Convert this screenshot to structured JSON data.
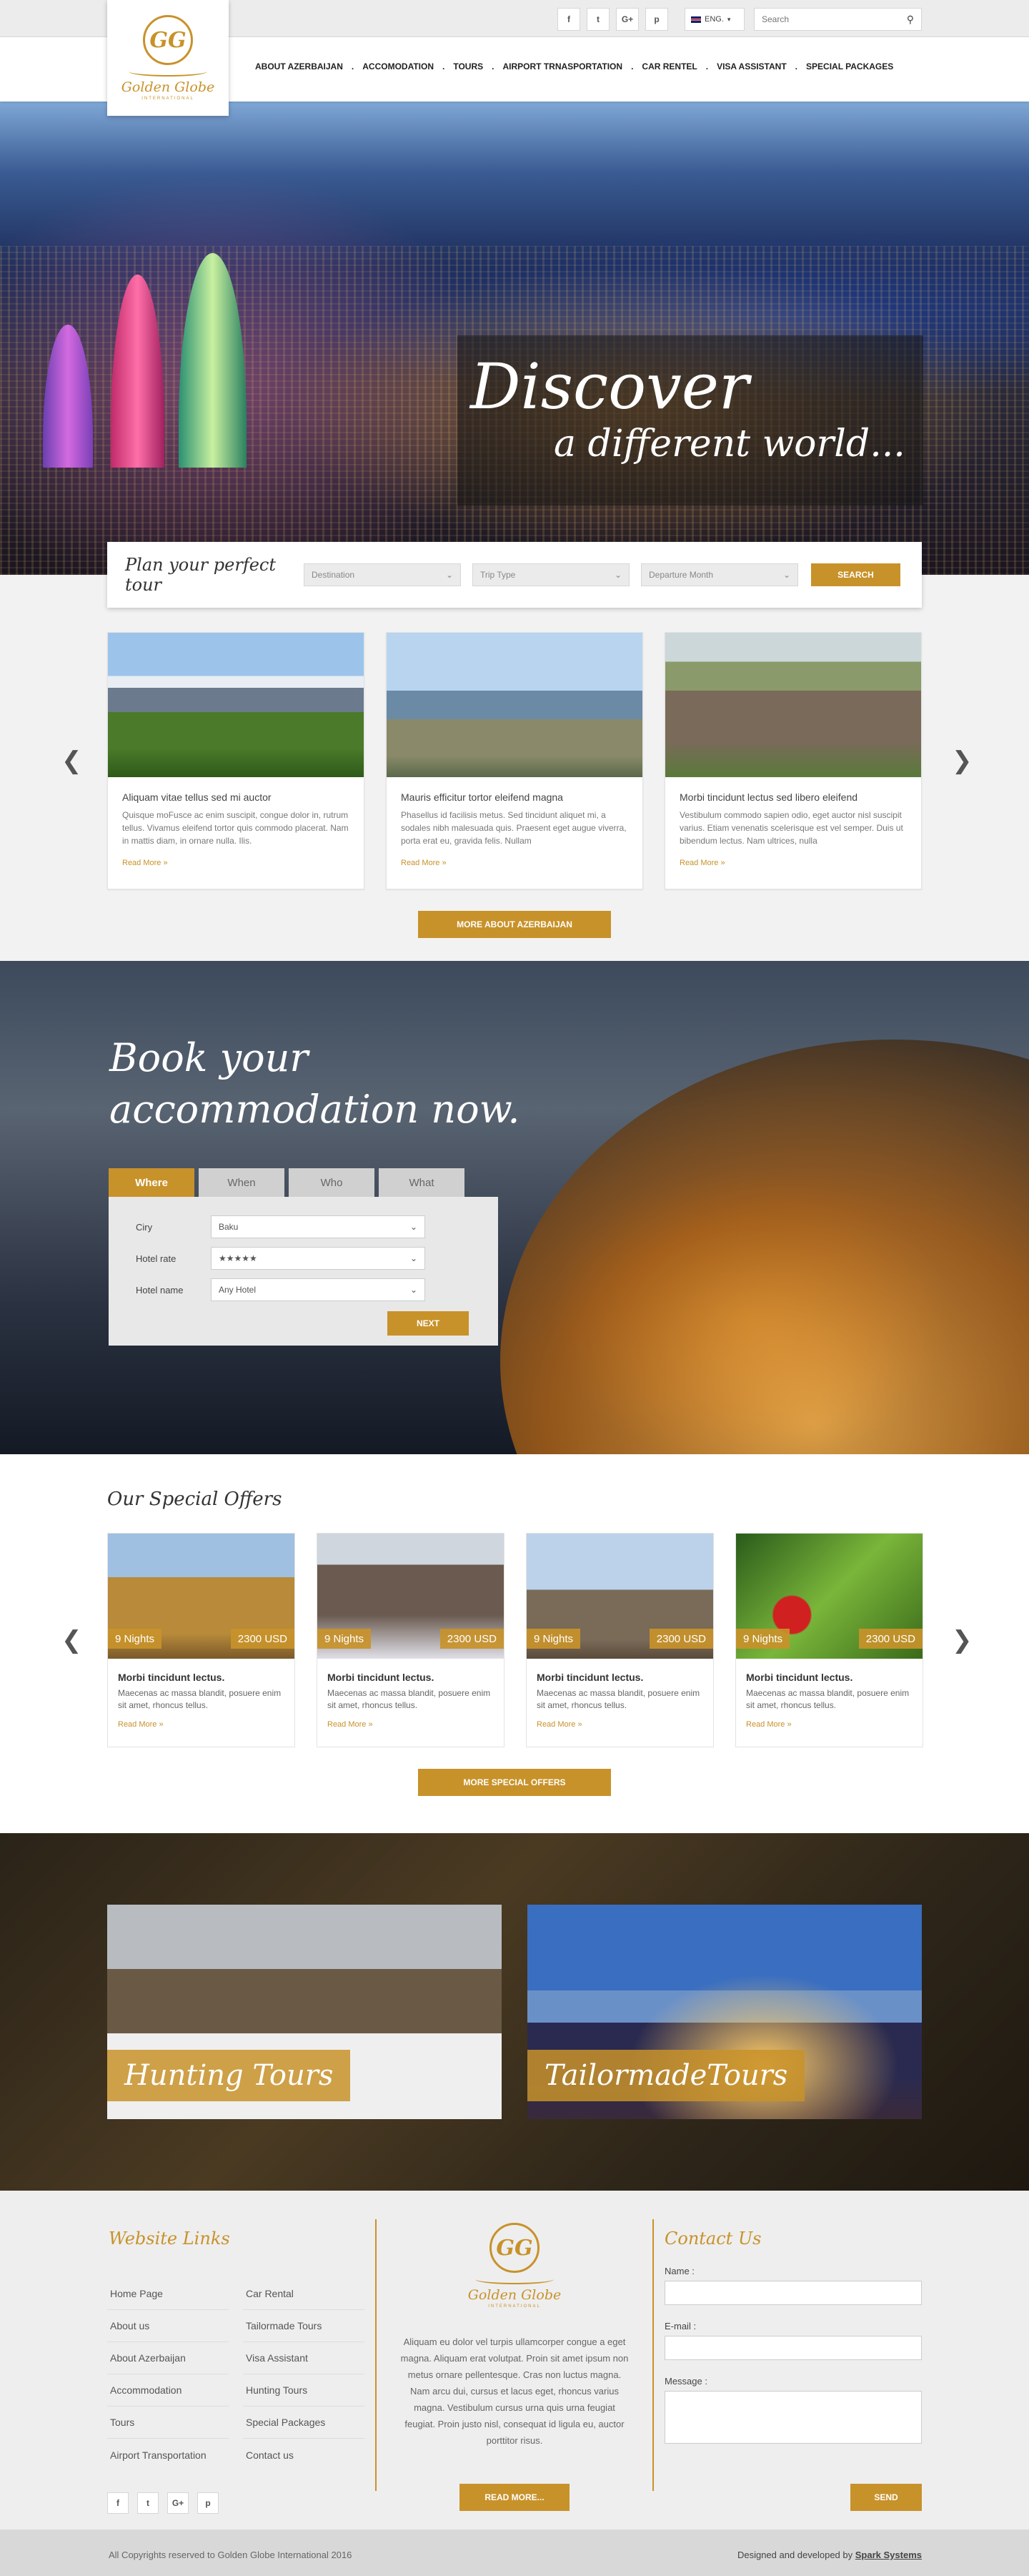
{
  "topbar": {
    "social": [
      "f",
      "t",
      "G+",
      "p"
    ],
    "language": "ENG.",
    "search_placeholder": "Search"
  },
  "logo": {
    "mark": "GG",
    "name": "Golden Globe",
    "sub": "INTERNATIONAL"
  },
  "nav": [
    "ABOUT AZERBAIJAN",
    "ACCOMODATION",
    "TOURS",
    "AIRPORT TRNASPORTATION",
    "CAR RENTEL",
    "VISA ASSISTANT",
    "SPECIAL PACKAGES"
  ],
  "hero": {
    "line1": "Discover",
    "line2": "a different world..."
  },
  "plan": {
    "title": "Plan your perfect tour",
    "destination": "Destination",
    "trip_type": "Trip Type",
    "departure": "Departure Month",
    "search": "SEARCH"
  },
  "destinations": [
    {
      "title": "Aliquam vitae tellus sed mi auctor",
      "text": "Quisque moFusce ac enim suscipit, congue dolor in, rutrum tellus. Vivamus eleifend tortor quis commodo placerat. Nam in mattis diam, in ornare nulla. Ilis.",
      "more": "Read More »"
    },
    {
      "title": "Mauris efficitur tortor eleifend magna",
      "text": "Phasellus id facilisis metus. Sed tincidunt aliquet mi, a sodales nibh malesuada quis. Praesent eget augue viverra, porta erat eu, gravida felis. Nullam",
      "more": "Read More »"
    },
    {
      "title": "Morbi tincidunt lectus sed libero eleifend",
      "text": "Vestibulum commodo sapien odio, eget auctor nisl suscipit varius. Etiam venenatis scelerisque est vel semper. Duis ut bibendum lectus. Nam ultrices, nulla",
      "more": "Read More »"
    }
  ],
  "more_azerbaijan": "MORE ABOUT AZERBAIJAN",
  "accommodation": {
    "title_1": "Book your",
    "title_2": "accommodation now.",
    "tabs": [
      "Where",
      "When",
      "Who",
      "What"
    ],
    "city_label": "Ciry",
    "city_value": "Baku",
    "rate_label": "Hotel rate",
    "rate_value": "★★★★★",
    "name_label": "Hotel name",
    "name_value": "Any Hotel",
    "next": "Next"
  },
  "offers": {
    "title": "Our Special Offers",
    "items": [
      {
        "nights": "9 Nights",
        "price": "2300 USD",
        "title": "Morbi tincidunt lectus.",
        "text": "Maecenas ac massa blandit, posuere enim sit amet, rhoncus tellus.",
        "more": "Read More »"
      },
      {
        "nights": "9 Nights",
        "price": "2300 USD",
        "title": "Morbi tincidunt lectus.",
        "text": "Maecenas ac massa blandit, posuere enim sit amet, rhoncus tellus.",
        "more": "Read More »"
      },
      {
        "nights": "9 Nights",
        "price": "2300 USD",
        "title": "Morbi tincidunt lectus.",
        "text": "Maecenas ac massa blandit, posuere enim sit amet, rhoncus tellus.",
        "more": "Read More »"
      },
      {
        "nights": "9 Nights",
        "price": "2300 USD",
        "title": "Morbi tincidunt lectus.",
        "text": "Maecenas ac massa blandit, posuere enim sit amet, rhoncus tellus.",
        "more": "Read More »"
      }
    ],
    "more": "MORE SPECIAL OFFERS"
  },
  "tours": [
    "Hunting Tours",
    "TailormadeTours"
  ],
  "footer": {
    "links_title": "Website Links",
    "links_col1": [
      "Home Page",
      "About us",
      "About Azerbaijan",
      "Accommodation",
      "Tours",
      "Airport Transportation"
    ],
    "links_col2": [
      "Car Rental",
      "Tailormade Tours",
      "Visa Assistant",
      "Hunting Tours",
      "Special Packages",
      "Contact us"
    ],
    "social": [
      "f",
      "t",
      "G+",
      "p"
    ],
    "about": "Aliquam eu dolor vel turpis ullamcorper congue a eget magna. Aliquam erat volutpat. Proin sit amet ipsum non metus ornare pellentesque. Cras non luctus magna. Nam arcu dui, cursus et lacus eget, rhoncus varius magna. Vestibulum cursus urna quis urna feugiat feugiat. Proin justo nisl, consequat id ligula eu, auctor porttitor risus.",
    "read_more": "Read More...",
    "contact_title": "Contact Us",
    "name_label": "Name :",
    "email_label": "E-mail :",
    "message_label": "Message :",
    "send": "Send",
    "copyright": "All Copyrights reserved to Golden Globe International 2016",
    "developed_prefix": "Designed and developed by",
    "developer": "Spark Systems"
  }
}
